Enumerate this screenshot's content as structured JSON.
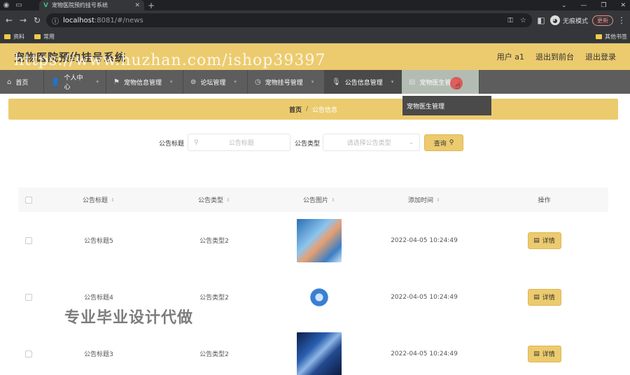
{
  "browser": {
    "tab_title": "宠物医院预约挂号系统",
    "url_host": "localhost",
    "url_path": ":8081/#/news",
    "incognito_label": "无痕模式",
    "update_label": "更新",
    "bookmarks": [
      "资料",
      "常用"
    ],
    "bookmarks_right": "其他书签"
  },
  "app": {
    "title": "宠物医院预约挂号系统",
    "watermark": "https://www.huzhan.com/ishop39397",
    "user": "用户 a1",
    "back_front": "退出到前台",
    "logout": "退出登录"
  },
  "nav": {
    "items": [
      {
        "label": "首页",
        "icon": "home-icon"
      },
      {
        "label": "个人中心",
        "icon": "user-icon"
      },
      {
        "label": "宠物信息管理",
        "icon": "flag-icon"
      },
      {
        "label": "论坛管理",
        "icon": "forum-icon"
      },
      {
        "label": "宠物挂号管理",
        "icon": "clock-icon"
      },
      {
        "label": "公告信息管理",
        "icon": "mic-icon"
      },
      {
        "label": "宠物医生管理",
        "icon": "doctor-icon"
      }
    ],
    "dropdown_item": "宠物医生管理"
  },
  "breadcrumb": {
    "home": "首页",
    "sep": "/",
    "current": "公告信息"
  },
  "search": {
    "title_label": "公告标题",
    "title_placeholder": "公告标题",
    "type_label": "公告类型",
    "type_placeholder": "请选择公告类型",
    "query_button": "查询"
  },
  "table": {
    "headers": {
      "title": "公告标题",
      "type": "公告类型",
      "image": "公告图片",
      "time": "添加时间",
      "op": "操作"
    },
    "rows": [
      {
        "title": "公告标题5",
        "type": "公告类型2",
        "time": "2022-04-05 10:24:49",
        "action": "详情"
      },
      {
        "title": "公告标题4",
        "type": "公告类型2",
        "time": "2022-04-05 10:24:49",
        "action": "详情"
      },
      {
        "title": "公告标题3",
        "type": "公告类型2",
        "time": "2022-04-05 10:24:49",
        "action": "详情"
      }
    ]
  },
  "overlay_text": "专业毕业设计代做"
}
